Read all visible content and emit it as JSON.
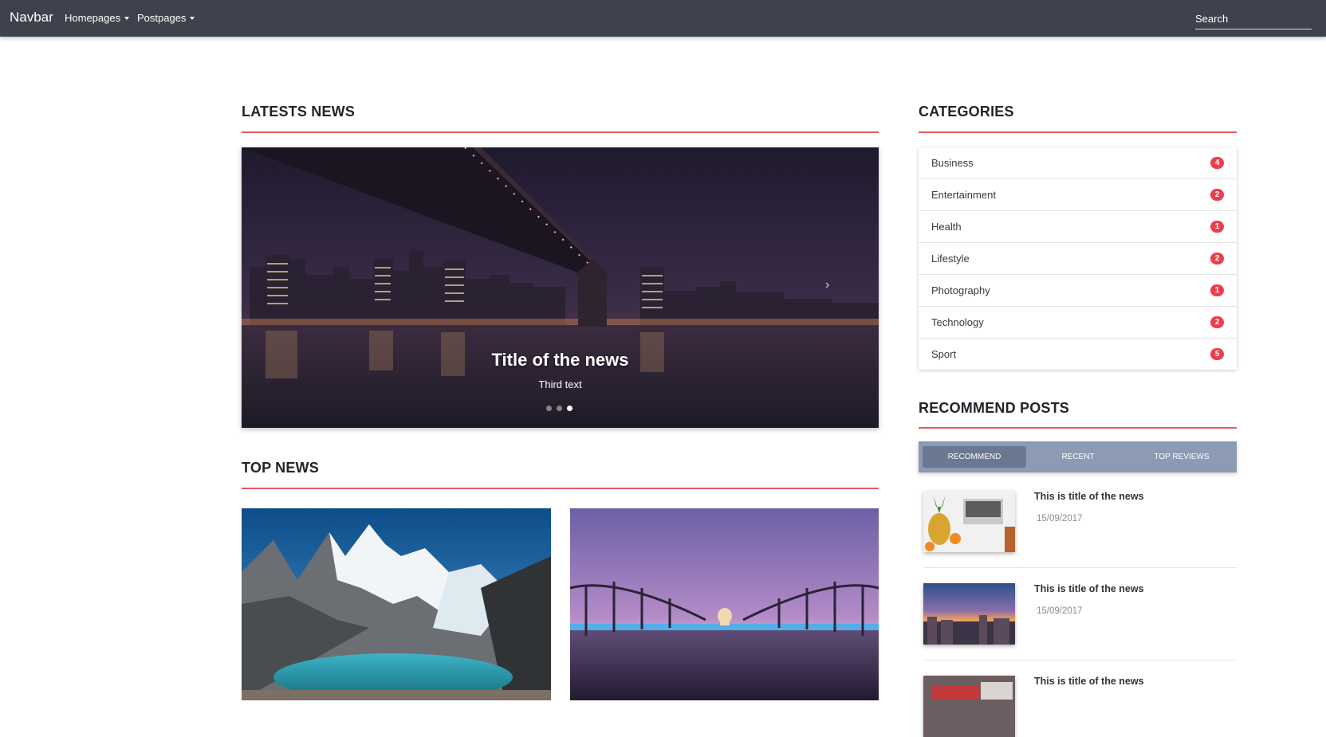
{
  "navbar": {
    "brand": "Navbar",
    "links": [
      {
        "label": "Homepages"
      },
      {
        "label": "Postpages"
      }
    ],
    "search_placeholder": "Search"
  },
  "latest_news": {
    "heading": "LATESTS NEWS",
    "slide": {
      "title": "Title of the news",
      "caption": "Third text"
    },
    "indicator_count": 3,
    "active_index": 2
  },
  "top_news": {
    "heading": "TOP NEWS"
  },
  "categories": {
    "heading": "CATEGORIES",
    "items": [
      {
        "label": "Business",
        "count": "4"
      },
      {
        "label": "Entertainment",
        "count": "2"
      },
      {
        "label": "Health",
        "count": "1"
      },
      {
        "label": "Lifestyle",
        "count": "2"
      },
      {
        "label": "Photography",
        "count": "1"
      },
      {
        "label": "Technology",
        "count": "2"
      },
      {
        "label": "Sport",
        "count": "5"
      }
    ]
  },
  "recommend_posts": {
    "heading": "RECOMMEND POSTS",
    "tabs": [
      {
        "label": "RECOMMEND",
        "active": true
      },
      {
        "label": "RECENT",
        "active": false
      },
      {
        "label": "TOP REVIEWS",
        "active": false
      }
    ],
    "posts": [
      {
        "title": "This is title of the news",
        "date": "15/09/2017"
      },
      {
        "title": "This is title of the news",
        "date": "15/09/2017"
      },
      {
        "title": "This is title of the news",
        "date": ""
      }
    ]
  },
  "colors": {
    "navbar_bg": "#3d424c",
    "accent_rule": "#e15b5b",
    "badge": "#ee3e4e",
    "tabs_bg": "#8c9ab4",
    "tab_active": "#6b7891"
  }
}
